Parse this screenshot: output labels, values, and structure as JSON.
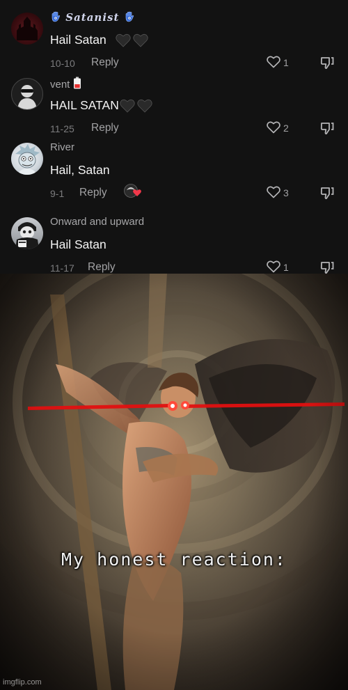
{
  "comments": [
    {
      "username": "𝑺𝒂𝒕𝒂𝒏𝒊𝒔𝒕",
      "username_emoji": "hamsa-icon",
      "text": "Hail Satan",
      "text_emoji": "black-heart-icon",
      "date": "10-10",
      "reply_label": "Reply",
      "likes": "1"
    },
    {
      "username": "vent",
      "username_emoji": "battery-icon",
      "text": "HAIL SATAN",
      "text_emoji": "black-heart-icon",
      "date": "11-25",
      "reply_label": "Reply",
      "likes": "2"
    },
    {
      "username": "River",
      "text": "Hail, Satan",
      "date": "9-1",
      "reply_label": "Reply",
      "likes": "3",
      "badge": "creator-liked-icon"
    },
    {
      "username": "Onward and upward",
      "text": "Hail Satan",
      "date": "11-17",
      "reply_label": "Reply",
      "likes": "1"
    }
  ],
  "meme": {
    "caption": "My honest reaction:",
    "watermark": "imgflip.com",
    "laser_color": "#e01010"
  },
  "colors": {
    "background": "#121212",
    "secondary_text": "#a2a2a4",
    "primary_text": "#f4f4f4"
  }
}
